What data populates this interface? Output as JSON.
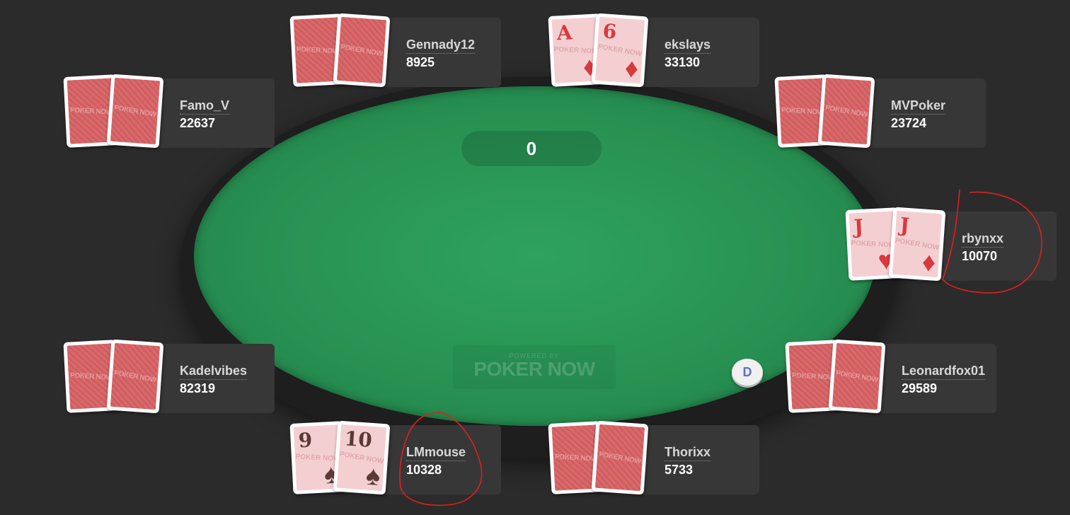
{
  "pot": "0",
  "logo": {
    "powered_by": "POWERED BY",
    "brand": "POKER NOW"
  },
  "dealer_button": "D",
  "card_back_logo": "POKER NOW",
  "players": {
    "gennady12": {
      "name": "Gennady12",
      "stack": "8925"
    },
    "ekslays": {
      "name": "ekslays",
      "stack": "33130",
      "cards": [
        {
          "rank": "A",
          "suit": "♦"
        },
        {
          "rank": "6",
          "suit": "♦"
        }
      ]
    },
    "famo_v": {
      "name": "Famo_V",
      "stack": "22637"
    },
    "mvpoker": {
      "name": "MVPoker",
      "stack": "23724"
    },
    "rbynxx": {
      "name": "rbynxx",
      "stack": "10070",
      "cards": [
        {
          "rank": "J",
          "suit": "♥"
        },
        {
          "rank": "J",
          "suit": "♦"
        }
      ]
    },
    "kadelvibes": {
      "name": "Kadelvibes",
      "stack": "82319"
    },
    "leonardfox01": {
      "name": "Leonardfox01",
      "stack": "29589"
    },
    "lmmouse": {
      "name": "LMmouse",
      "stack": "10328",
      "cards": [
        {
          "rank": "9",
          "suit": "♠"
        },
        {
          "rank": "10",
          "suit": "♠"
        }
      ]
    },
    "thorixx": {
      "name": "Thorixx",
      "stack": "5733"
    }
  },
  "colors": {
    "background": "#2b2b2b",
    "felt": "#289253",
    "card_back": "#d96a6c",
    "red_suit": "#d8393d",
    "annotation": "#e02020"
  }
}
